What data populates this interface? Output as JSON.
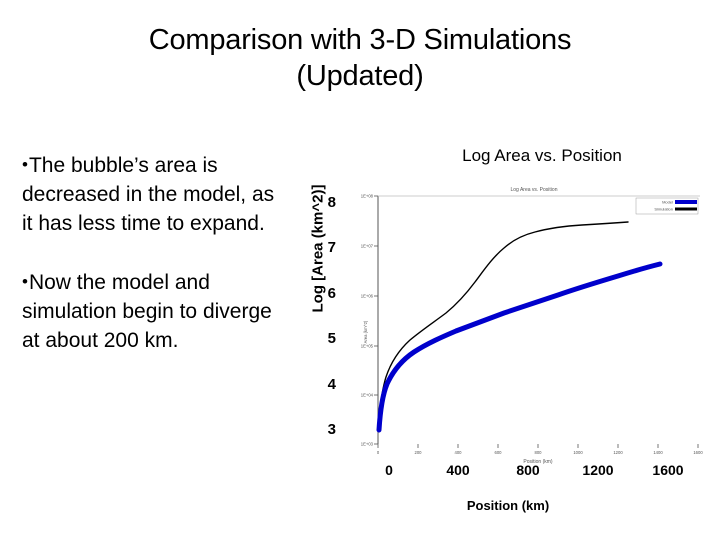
{
  "slide": {
    "title_line1": "Comparison with 3-D Simulations",
    "title_line2": "(Updated)"
  },
  "bullets": [
    {
      "marker": "•",
      "text": "The bubble’s area is decreased in the model, as it  has less time to expand."
    },
    {
      "marker": "•",
      "text": "Now the model and simulation begin to diverge at about 200 km."
    }
  ],
  "chart": {
    "heading": "Log Area vs. Position",
    "inner_title": "Log Area vs. Position",
    "inner_xlabel": "Position (km)",
    "inner_ylabel": "Log [Area (km^2)]",
    "legend": [
      {
        "label": "Model",
        "color": "#0000CC"
      },
      {
        "label": "Simulation",
        "color": "#000000"
      }
    ],
    "axes": {
      "ylabel": "Log [Area (km^2)]",
      "yticks": [
        "8",
        "7",
        "6",
        "5",
        "4",
        "3"
      ],
      "xlabel": "Position (km)",
      "xticks": [
        "0",
        "400",
        "800",
        "1200",
        "1600"
      ]
    }
  },
  "chart_data": {
    "type": "line",
    "title": "Log Area vs. Position",
    "xlabel": "Position (km)",
    "ylabel": "Log [Area (km^2)]",
    "xlim": [
      0,
      1600
    ],
    "ylim": [
      3,
      8
    ],
    "grid": false,
    "legend_position": "top-right",
    "series": [
      {
        "name": "Model",
        "color": "#0000CC",
        "linewidth": 5,
        "x": [
          5,
          10,
          20,
          35,
          55,
          80,
          120,
          170,
          230,
          300,
          390,
          490,
          600,
          720,
          850,
          980,
          1100,
          1220,
          1330,
          1430,
          1500
        ],
        "y": [
          3.75,
          4.05,
          4.42,
          4.7,
          4.92,
          5.08,
          5.28,
          5.45,
          5.6,
          5.73,
          5.86,
          5.97,
          6.08,
          6.19,
          6.3,
          6.4,
          6.49,
          6.57,
          6.64,
          6.7,
          6.74
        ]
      },
      {
        "name": "Simulation",
        "color": "#000000",
        "linewidth": 1.4,
        "x": [
          5,
          12,
          25,
          45,
          70,
          105,
          150,
          205,
          270,
          345,
          430,
          520,
          610,
          700,
          790,
          880,
          970,
          1060,
          1150,
          1240,
          1330
        ],
        "y": [
          3.72,
          4.1,
          4.48,
          4.78,
          5.0,
          5.2,
          5.4,
          5.58,
          5.82,
          6.12,
          6.45,
          6.75,
          7.0,
          7.14,
          7.22,
          7.27,
          7.31,
          7.34,
          7.36,
          7.38,
          7.4
        ]
      }
    ]
  },
  "colors": {
    "model_blue": "#0000CC",
    "simulation_black": "#000000",
    "axis_gray": "#555555",
    "text_black": "#000000"
  }
}
